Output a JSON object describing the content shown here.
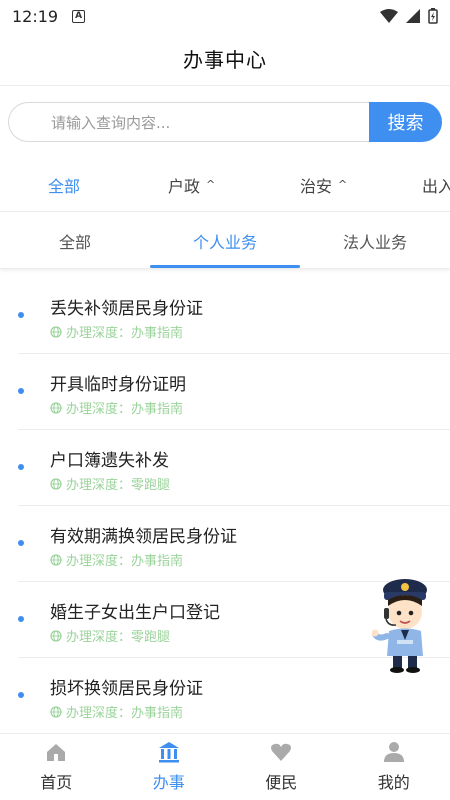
{
  "status": {
    "time": "12:19",
    "a_icon": "A"
  },
  "header": {
    "title": "办事中心"
  },
  "search": {
    "placeholder": "请输入查询内容...",
    "button_label": "搜索"
  },
  "categories": [
    {
      "label": "全部"
    },
    {
      "label": "户政"
    },
    {
      "label": "治安"
    },
    {
      "label": "出入"
    }
  ],
  "tabs": [
    {
      "label": "全部"
    },
    {
      "label": "个人业务"
    },
    {
      "label": "法人业务"
    }
  ],
  "items": [
    {
      "title": "丢失补领居民身份证",
      "subtitle": "办理深度：办事指南"
    },
    {
      "title": "开具临时身份证明",
      "subtitle": "办理深度：办事指南"
    },
    {
      "title": "户口簿遗失补发",
      "subtitle": "办理深度：零跑腿"
    },
    {
      "title": "有效期满换领居民身份证",
      "subtitle": "办理深度：办事指南"
    },
    {
      "title": "婚生子女出生户口登记",
      "subtitle": "办理深度：零跑腿"
    },
    {
      "title": "损坏换领居民身份证",
      "subtitle": "办理深度：办事指南"
    }
  ],
  "nav": [
    {
      "label": "首页",
      "icon": "home-icon"
    },
    {
      "label": "办事",
      "icon": "bank-icon"
    },
    {
      "label": "便民",
      "icon": "heart-icon"
    },
    {
      "label": "我的",
      "icon": "user-icon"
    }
  ],
  "colors": {
    "accent": "#3e8ff0",
    "subtitle": "#9bd39b",
    "inactive_icon": "#aaaaaa"
  }
}
